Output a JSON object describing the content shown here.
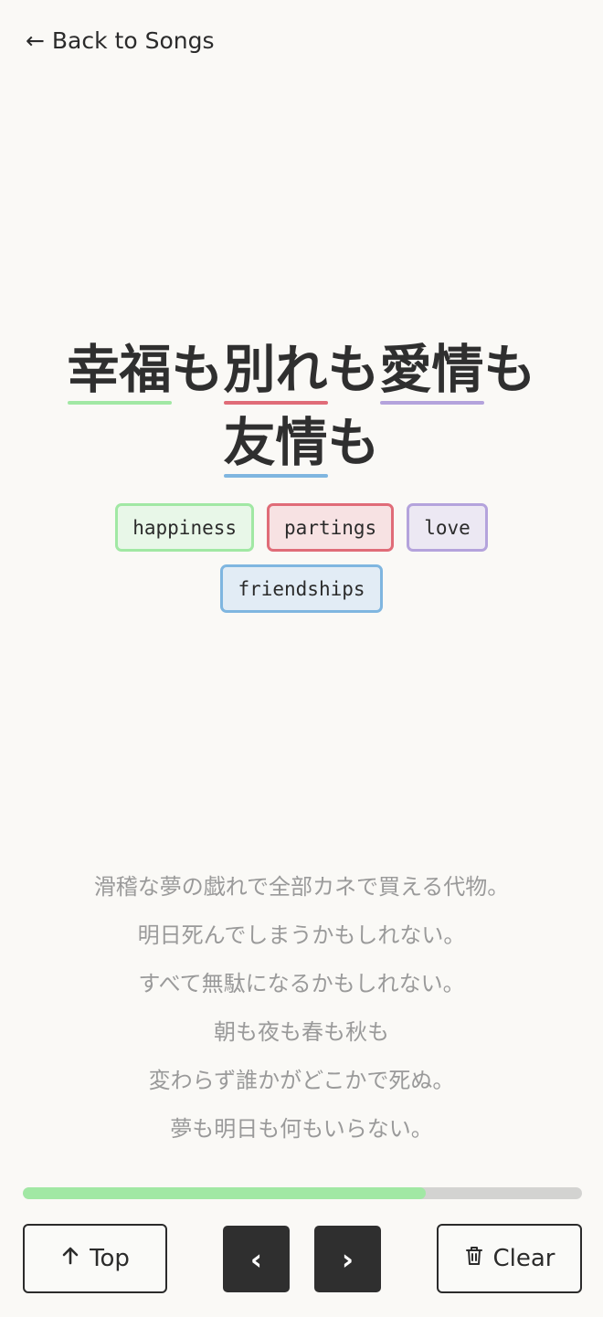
{
  "nav": {
    "back_label": "← Back to Songs"
  },
  "lyric": {
    "lines": [
      [
        {
          "text": "幸福",
          "highlight": "#a1e8a4"
        },
        {
          "text": "も"
        },
        {
          "text": "別れ",
          "highlight": "#e06c78"
        },
        {
          "text": "も"
        },
        {
          "text": "愛情",
          "highlight": "#b4a3dc"
        },
        {
          "text": "も"
        }
      ],
      [
        {
          "text": "友情",
          "highlight": "#7fb6e0"
        },
        {
          "text": "も"
        }
      ]
    ]
  },
  "translations": [
    [
      {
        "label": "happiness",
        "border": "#a1e8a4",
        "bg": "#e8f7e8"
      },
      {
        "label": "partings",
        "border": "#e06c78",
        "bg": "#f7e2e3"
      },
      {
        "label": "love",
        "border": "#b4a3dc",
        "bg": "#ece8f3"
      }
    ],
    [
      {
        "label": "friendships",
        "border": "#7fb6e0",
        "bg": "#e2ecf5"
      }
    ]
  ],
  "upcoming_lines": [
    "滑稽な夢の戯れで全部カネで買える代物。",
    "明日死んでしまうかもしれない。",
    "すべて無駄になるかもしれない。",
    "朝も夜も春も秋も",
    "変わらず誰かがどこかで死ぬ。",
    "夢も明日も何もいらない。"
  ],
  "progress": {
    "fraction": 0.72,
    "color": "#a1e8a4"
  },
  "controls": {
    "top_label": "Top",
    "prev_label": "‹",
    "next_label": "›",
    "clear_label": "Clear"
  }
}
